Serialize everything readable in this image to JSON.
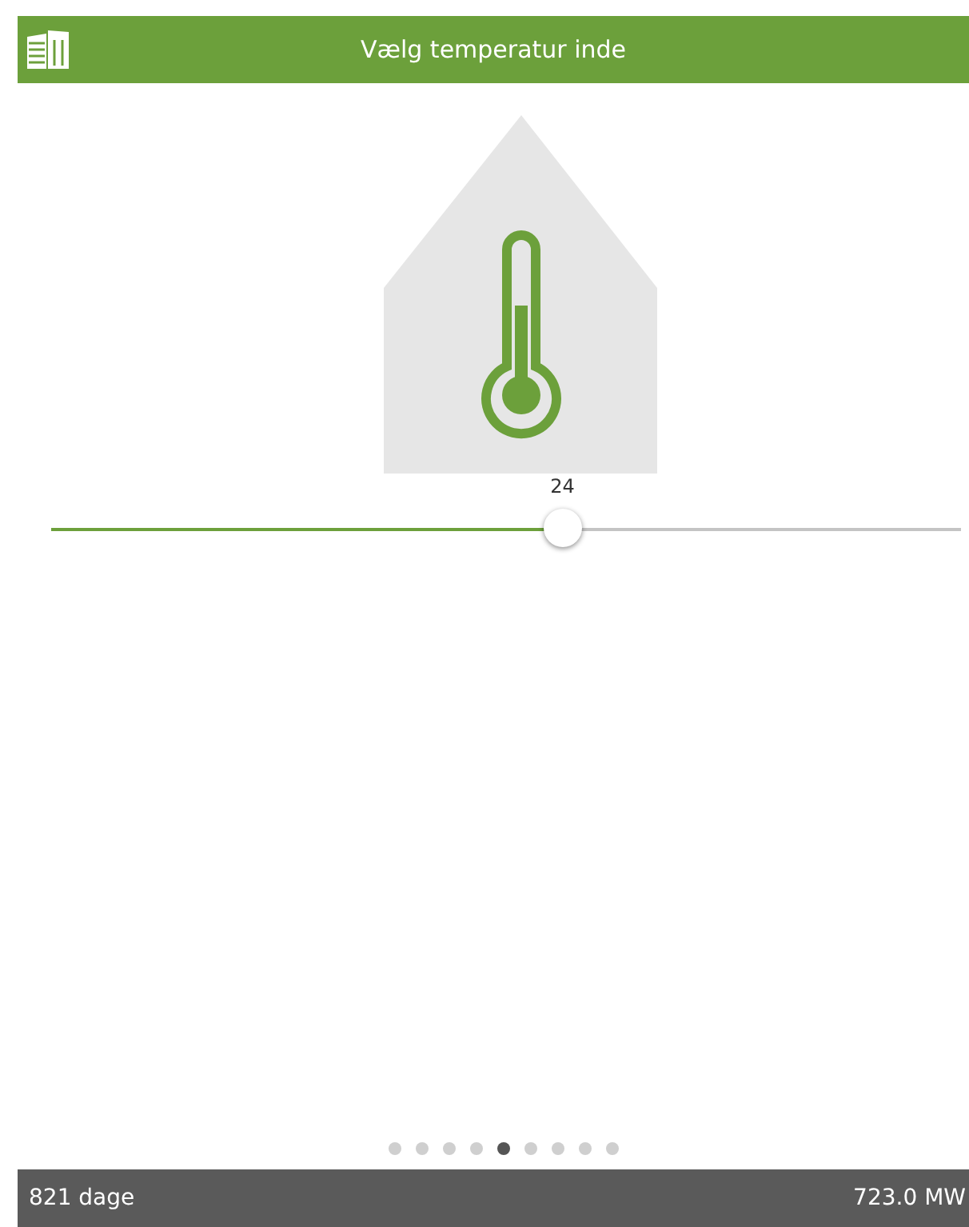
{
  "header": {
    "title": "Vælg temperatur inde"
  },
  "slider": {
    "value": "24",
    "level": 0.562
  },
  "pager": [
    {
      "selected": false
    },
    {
      "selected": false
    },
    {
      "selected": false
    },
    {
      "selected": false
    },
    {
      "selected": true
    },
    {
      "selected": false
    },
    {
      "selected": false
    },
    {
      "selected": false
    },
    {
      "selected": false
    }
  ],
  "status_bar": {
    "left": "821 dage",
    "right": "723.0 MW"
  }
}
